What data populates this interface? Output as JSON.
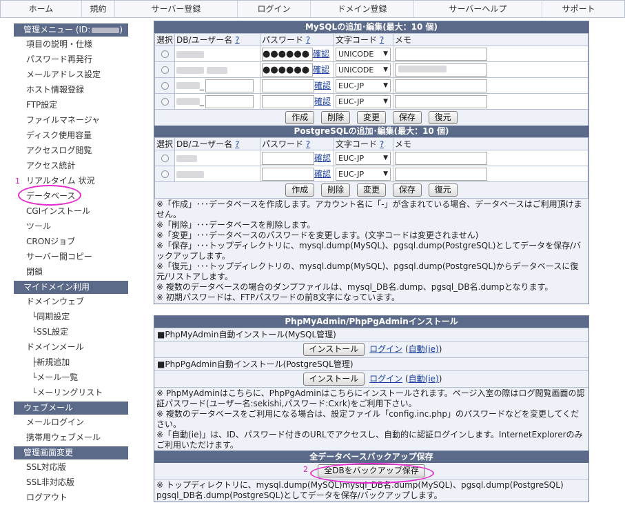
{
  "topnav": [
    "ホーム",
    "規約",
    "サーバー登録",
    "ログイン",
    "ドメイン登録",
    "サーバーヘルプ",
    "サポート"
  ],
  "sidebar": {
    "sections": [
      {
        "title": "管理メニュー (ID:",
        "items": [
          "項目の説明・仕様",
          "パスワード再発行",
          "メールアドレス設定",
          "ホスト情報登録",
          "FTP設定",
          "ファイルマネージャ",
          "ディスク使用容量",
          "アクセスログ閲覧",
          "アクセス統計",
          "リアルタイム 状況",
          "データベース",
          "CGIインストール",
          "ツール",
          "CRONジョブ",
          "サーバー間コピー",
          "閉鎖"
        ]
      },
      {
        "title": "マイドメイン利用",
        "items": [
          "ドメインウェブ",
          "└同期設定",
          "└SSL設定",
          "ドメインメール",
          "├新規追加",
          "└メール一覧",
          "└メーリングリスト"
        ]
      },
      {
        "title": "ウェブメール",
        "items": [
          "メールログイン",
          "携帯用ウェブメール"
        ]
      },
      {
        "title": "管理画面変更",
        "items": [
          "SSL対応版",
          "SSL非対応版",
          "ログアウト"
        ]
      }
    ],
    "annotation_num": "1"
  },
  "mysql": {
    "title": "MySQLの追加･編集(最大：10 個)",
    "headers": {
      "select": "選択",
      "db_user": "DB/ユーザー名",
      "help": "?",
      "password": "パスワード",
      "charset": "文字コード",
      "memo": "メモ"
    },
    "rows": [
      {
        "charset": "UNICODE",
        "has_pw": true,
        "suffix": ""
      },
      {
        "charset": "UNICODE",
        "has_pw": true,
        "suffix": ""
      },
      {
        "charset": "EUC-JP",
        "has_pw": false,
        "suffix": "_"
      },
      {
        "charset": "EUC-JP",
        "has_pw": false,
        "suffix": "_"
      }
    ],
    "confirm": "確認",
    "pw_dots": "●●●●●●",
    "buttons": [
      "作成",
      "削除",
      "変更",
      "保存",
      "復元"
    ]
  },
  "postgres": {
    "title": "PostgreSQLの追加･編集(最大：10 個)",
    "rows": [
      {
        "charset": "EUC-JP"
      },
      {
        "charset": "EUC-JP"
      }
    ]
  },
  "notes": [
    "※「作成」･･･データベースを作成します。アカウント名に「-」が含まれている場合、データベースはご利用頂けません。",
    "※「削除」･･･データベースを削除します。",
    "※「変更」･･･データベースのパスワードを変更します。(文字コードは変更されません)",
    "※「保存」･･･トップディレクトリに、mysql.dump(MySQL)、pgsql.dump(PostgreSQL)としてデータを保存/バックアップします。",
    "※「復元」･･･トップディレクトリの、mysql.dump(MySQL)、pgsql.dump(PostgreSQL)からデータベースに復元/リストアします。",
    "※ 複数のデータベースの場合のダンプファイルは、mysql_DB名.dump、pgsql_DB名.dumpとなります。",
    "※ 初期パスワードは、FTPパスワードの前8文字になっています。"
  ],
  "phpadmin": {
    "title": "PhpMyAdmin/PhpPgAdminインストール",
    "sub1": "■PhpMyAdmin自動インストール(MySQL管理)",
    "sub2": "■PhpPgAdmin自動インストール(PostgreSQL管理)",
    "install": "インストール",
    "login": "ログイン",
    "auto": "自動(ie)",
    "notes": [
      "※ PhpMyAdminはこちらに、PhpPgAdminはこちらにインストールされます。ページ入室の際はログ閲覧画面の認証パスワード(ユーザー名:sekishi,パスワード:Cxrk)をご利用下さい。",
      "※ 複数のデータベースをご利用になる場合は、設定ファイル「config.inc.php」のパスワードなどを変更してください。",
      "※「自動(ie)」は、ID、パスワード付きのURLでアクセスし、自動的に認証ログインします。InternetExplorerのみご利用いただけます。"
    ]
  },
  "backup": {
    "title": "全データベースバックアップ保存",
    "button": "全DBをバックアップ保存",
    "annotation_num": "2",
    "note": "※ トップディレクトリに、mysql.dump(MySQL)mysql_DB名.dump(MySQL)、pgsql.dump(PostgreSQL) pgsql_DB名.dump(PostgreSQL)としてデータを保存/バックアップします。"
  }
}
